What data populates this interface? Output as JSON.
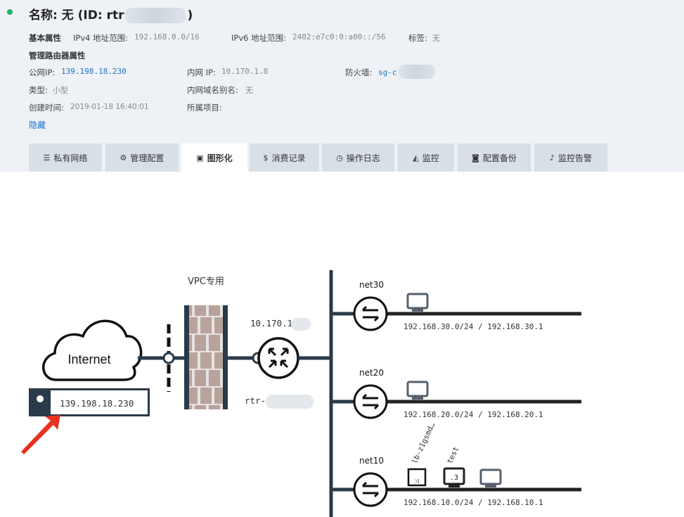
{
  "header": {
    "title": "名称: 无 (ID: rtr",
    "title_close": ")",
    "basic_label": "基本属性",
    "ipv4_label": "IPv4 地址范围:",
    "ipv4_value": "192.168.0.0/16",
    "ipv6_label": "IPv6 地址范围:",
    "ipv6_value": "2402:e7c0:0:a00::/56",
    "tag_label": "标签:",
    "tag_value": "无",
    "managed_label": "管理路由器属性",
    "public_ip_label": "公网IP:",
    "public_ip_value": "139.198.18.230",
    "private_ip_label": "内网 IP:",
    "private_ip_value": "10.170.1.8",
    "firewall_label": "防火墙:",
    "firewall_value": "sg-c",
    "type_label": "类型:",
    "type_value": "小型",
    "domain_alias_label": "内网域名别名:",
    "domain_alias_value": "无",
    "created_label": "创建时间:",
    "created_value": "2019-01-18 16:40:01",
    "project_label": "所属项目:",
    "hide_link": "隐藏"
  },
  "tabs": [
    {
      "icon": "list-icon",
      "glyph": "☰",
      "label": "私有网络"
    },
    {
      "icon": "gears-icon",
      "glyph": "⚙",
      "label": "管理配置"
    },
    {
      "icon": "image-icon",
      "glyph": "▣",
      "label": "图形化"
    },
    {
      "icon": "dollar-icon",
      "glyph": "$",
      "label": "消费记录"
    },
    {
      "icon": "clock-icon",
      "glyph": "◷",
      "label": "操作日志"
    },
    {
      "icon": "area-chart-icon",
      "glyph": "◭",
      "label": "监控"
    },
    {
      "icon": "camera-icon",
      "glyph": "◙",
      "label": "配置备份"
    },
    {
      "icon": "bell-icon",
      "glyph": "♪",
      "label": "监控告警"
    }
  ],
  "active_tab": "图形化",
  "diagram": {
    "internet_label": "Internet",
    "eip_value": "139.198.18.230",
    "vpc_label": "VPC专用",
    "router_ip": "10.170.1",
    "router_name": "rtr-",
    "networks": [
      {
        "name": "net30",
        "cidr": "192.168.30.0/24 / 192.168.30.1"
      },
      {
        "name": "net20",
        "cidr": "192.168.20.0/24 / 192.168.20.1"
      },
      {
        "name": "net10",
        "cidr": "192.168.10.0/24 / 192.168.10.1"
      }
    ],
    "net10_hosts": {
      "lb_label": "lb-z1gsmd…",
      "lb_glyph": "⤨",
      "test_label": "test",
      "test_glyph": ".3"
    }
  },
  "colors": {
    "line": "#2b3a4a",
    "accent_link": "#1a73c9",
    "status_green": "#1fb36a",
    "arrow_red": "#e8321e",
    "brick": "#b8a39c"
  }
}
